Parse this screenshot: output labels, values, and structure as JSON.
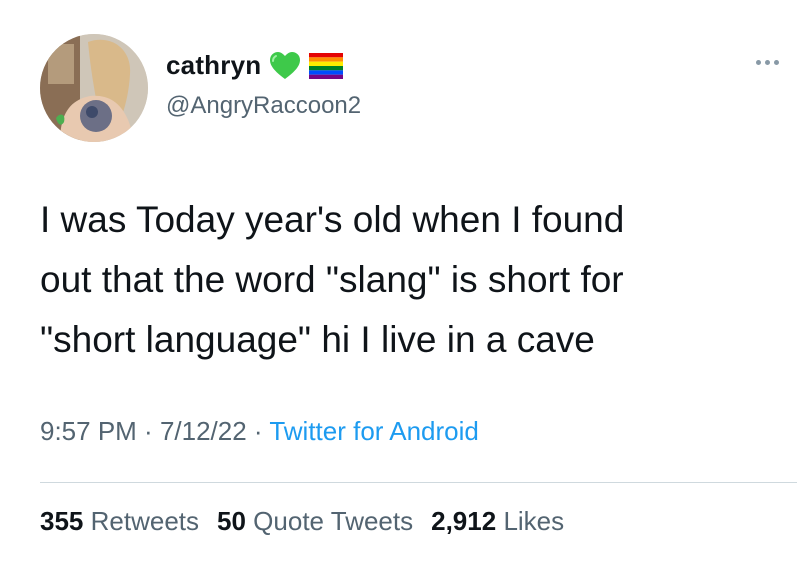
{
  "author": {
    "display_name": "cathryn",
    "handle": "@AngryRaccoon2",
    "badges": [
      "green-heart-icon",
      "rainbow-flag-icon"
    ]
  },
  "tweet": {
    "text": "I was Today year's old when I found\nout that the word \"slang\" is short for\n\"short language\" hi I live in a cave"
  },
  "meta": {
    "time": "9:57 PM",
    "sep1": " · ",
    "date": "7/12/22",
    "sep2": " · ",
    "source": "Twitter for Android"
  },
  "stats": {
    "retweets_count": "355",
    "retweets_label": "Retweets",
    "quotes_count": "50",
    "quotes_label": "Quote Tweets",
    "likes_count": "2,912",
    "likes_label": "Likes"
  },
  "colors": {
    "text": "#0f1419",
    "secondary": "#536471",
    "link": "#1d9bf0",
    "divider": "#cfd9de",
    "heart": "#3ec94a"
  }
}
